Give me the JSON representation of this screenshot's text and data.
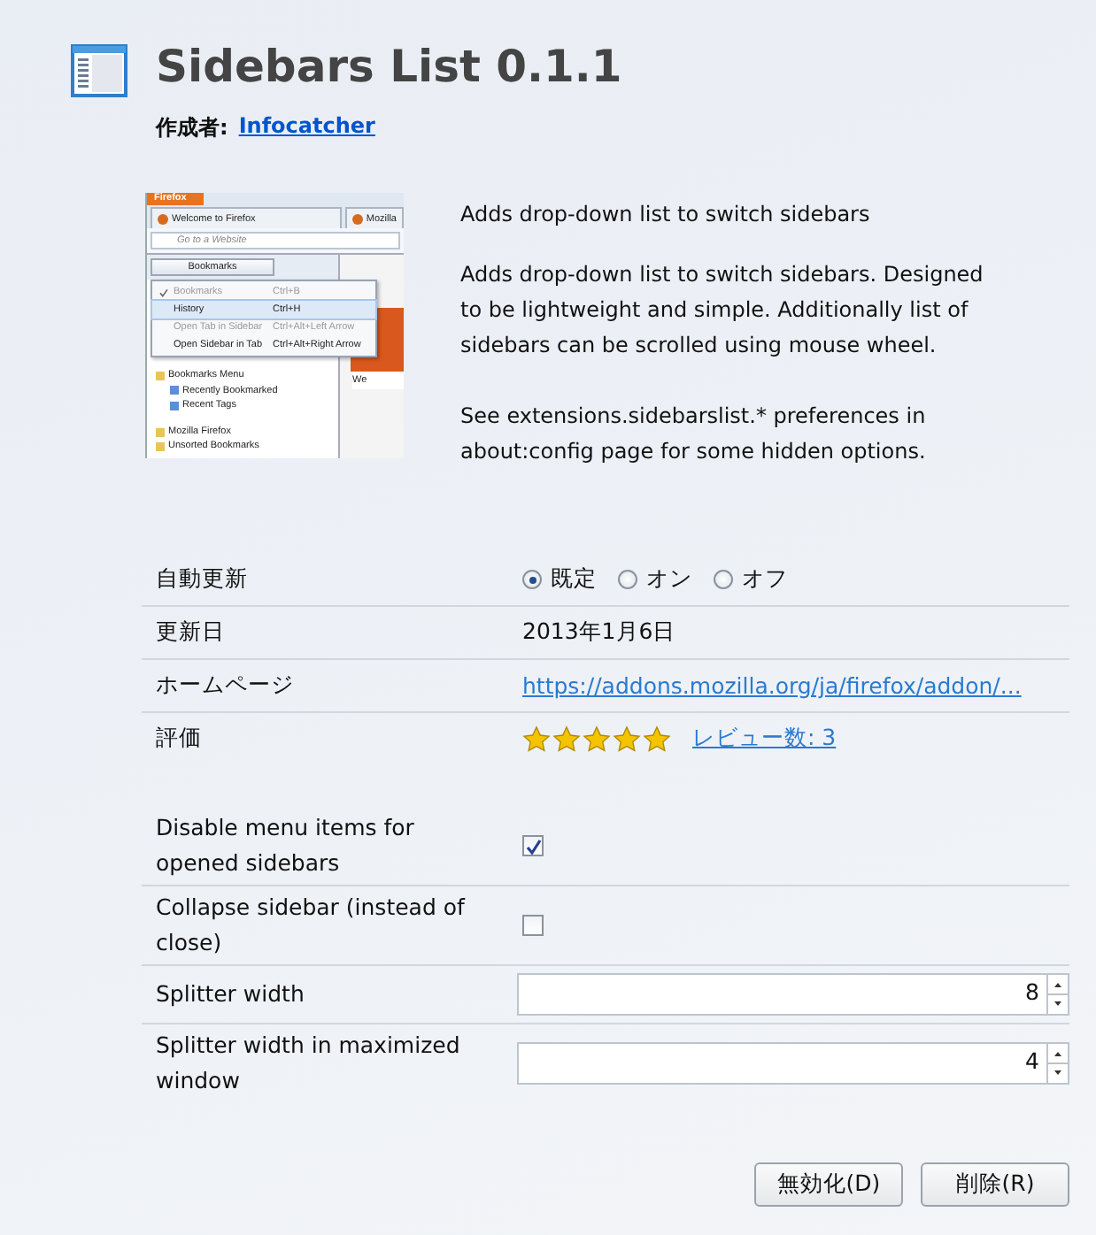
{
  "header": {
    "title": "Sidebars List 0.1.1",
    "author_label": "作成者:",
    "author": "Infocatcher"
  },
  "screenshot": {
    "app_button": "Firefox",
    "tabs": [
      "Welcome to Firefox",
      "Mozilla"
    ],
    "address_placeholder": "Go to a Website",
    "sidebar_select": "Bookmarks",
    "menu": [
      {
        "label": "Bookmarks",
        "shortcut": "Ctrl+B",
        "checked": true,
        "disabled": true,
        "selected": false
      },
      {
        "label": "History",
        "shortcut": "Ctrl+H",
        "checked": false,
        "disabled": false,
        "selected": true
      },
      {
        "label": "Open Tab in Sidebar",
        "shortcut": "Ctrl+Alt+Left Arrow",
        "checked": false,
        "disabled": true,
        "selected": false
      },
      {
        "label": "Open Sidebar in Tab",
        "shortcut": "Ctrl+Alt+Right Arrow",
        "checked": false,
        "disabled": false,
        "selected": false
      }
    ],
    "tree": [
      {
        "label": "Bookmarks Menu",
        "children": [
          {
            "label": "Recently Bookmarked"
          },
          {
            "label": "Recent Tags"
          }
        ]
      },
      {
        "label": "Mozilla Firefox"
      },
      {
        "label": "Unsorted Bookmarks"
      }
    ],
    "page_text": "We"
  },
  "description": {
    "summary": "Adds drop-down list to switch sidebars",
    "paragraphs": [
      "Adds drop-down list to switch sidebars. Designed to be lightweight and simple. Additionally list of sidebars can be scrolled using mouse wheel.",
      "See extensions.sidebarslist.* preferences in about:config page for some hidden options."
    ]
  },
  "details": [
    {
      "kind": "radio",
      "label": "自動更新",
      "options": [
        {
          "label": "既定",
          "selected": true
        },
        {
          "label": "オン",
          "selected": false
        },
        {
          "label": "オフ",
          "selected": false
        }
      ]
    },
    {
      "kind": "text",
      "label": "更新日",
      "value": "2013年1月6日"
    },
    {
      "kind": "link",
      "label": "ホームページ",
      "value": "https://addons.mozilla.org/ja/firefox/addon/..."
    },
    {
      "kind": "rating",
      "label": "評価",
      "stars": 5,
      "value": "レビュー数: 3"
    }
  ],
  "preferences": [
    {
      "kind": "checkbox",
      "label": "Disable menu items for opened sidebars",
      "checked": true
    },
    {
      "kind": "checkbox",
      "label": "Collapse sidebar (instead of close)",
      "checked": false
    },
    {
      "kind": "number",
      "label": "Splitter width",
      "value": "8"
    },
    {
      "kind": "number",
      "label": "Splitter width in maximized window",
      "value": "4"
    }
  ],
  "buttons": [
    "無効化(D)",
    "削除(R)"
  ]
}
